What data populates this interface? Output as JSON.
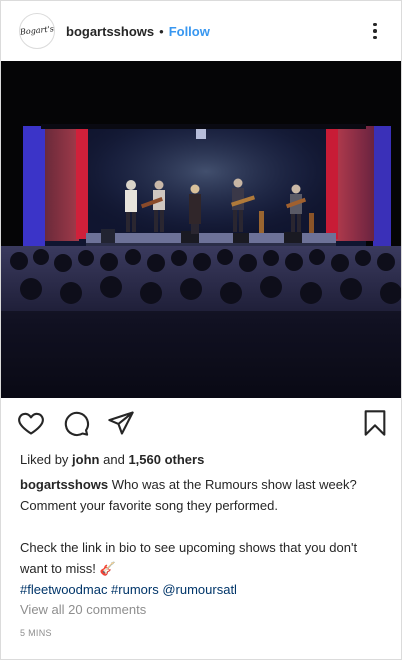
{
  "header": {
    "avatar_text": "Bogart's",
    "username": "bogartsshows",
    "separator": "•",
    "follow_label": "Follow"
  },
  "photo": {
    "description": "Band performing on a stage with red and blue lighting in front of a crowd"
  },
  "actions": {
    "icons": [
      "heart-icon",
      "comment-icon",
      "share-icon",
      "bookmark-icon"
    ]
  },
  "likes": {
    "prefix": "Liked by",
    "user": "john",
    "connector": "and",
    "others": "1,560 others"
  },
  "caption": {
    "username": "bogartsshows",
    "line1": "Who was at the Rumours show last week? Comment your favorite song they performed.",
    "line2": "Check the link in bio to see upcoming shows that you don't want to miss! 🎸",
    "tags": "#fleetwoodmac #rumors @rumoursatl"
  },
  "comments_link": "View all 20 comments",
  "timestamp": "5 MINS",
  "colors": {
    "link_blue": "#3897f0",
    "hashtag": "#003569",
    "muted": "#8e8e8e",
    "text": "#262626"
  }
}
